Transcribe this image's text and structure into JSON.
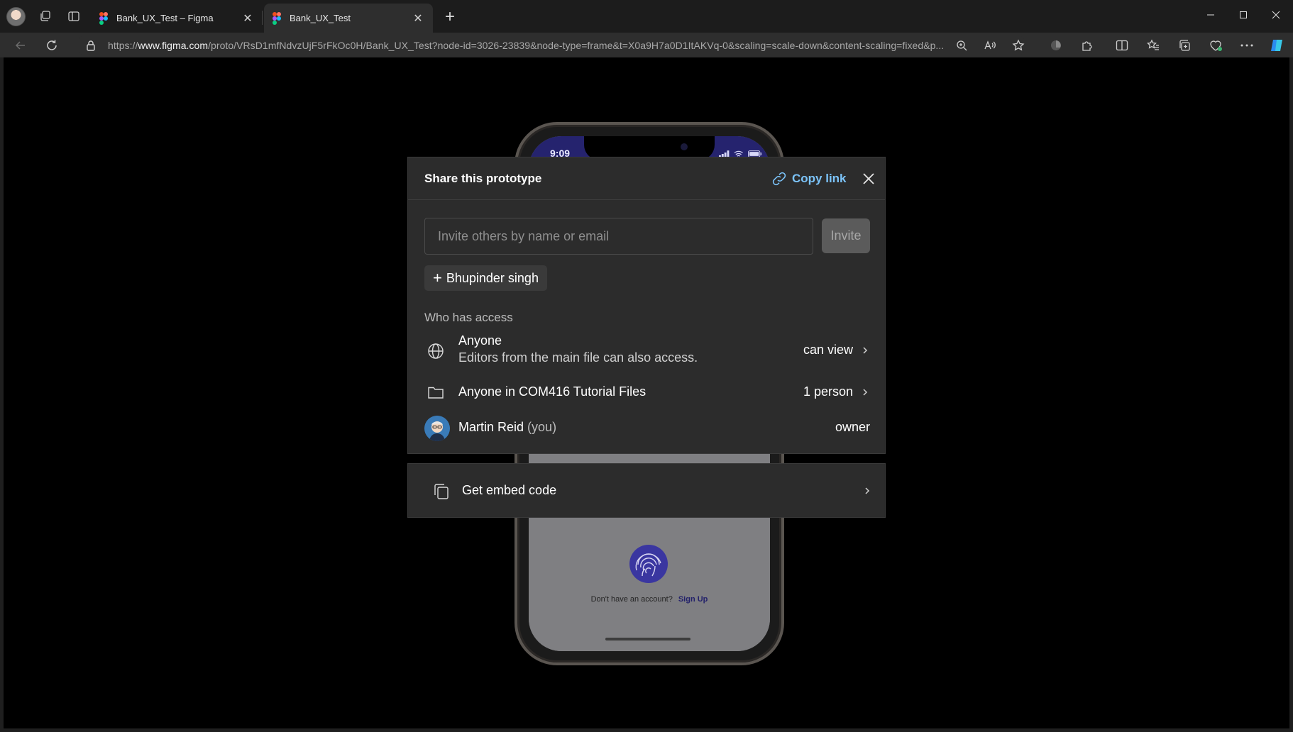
{
  "browser": {
    "tabs": [
      {
        "title": "Bank_UX_Test – Figma",
        "active": false
      },
      {
        "title": "Bank_UX_Test",
        "active": true
      }
    ],
    "url_prefix": "https://",
    "url_host": "www.figma.com",
    "url_rest": "/proto/VRsD1mfNdvzUjF5rFkOc0H/Bank_UX_Test?node-id=3026-23839&node-type=frame&t=X0a9H7a0D1ItAKVq-0&scaling=scale-down&content-scaling=fixed&p..."
  },
  "phone": {
    "time": "9:09",
    "no_account_text": "Don't have an account?",
    "signup_label": "Sign Up"
  },
  "share_dialog": {
    "title": "Share this prototype",
    "copy_link_label": "Copy link",
    "invite_placeholder": "Invite others by name or email",
    "invite_button_label": "Invite",
    "suggestion_label": "Bhupinder singh",
    "access_heading": "Who has access",
    "access": [
      {
        "name": "Anyone",
        "description": "Editors from the main file can also access.",
        "permission": "can view",
        "icon": "globe-icon"
      },
      {
        "name": "Anyone in COM416 Tutorial Files",
        "permission": "1 person",
        "icon": "folder-icon"
      },
      {
        "name": "Martin Reid",
        "qualifier": "(you)",
        "permission": "owner",
        "icon": "avatar"
      }
    ],
    "embed_label": "Get embed code"
  },
  "colors": {
    "accent_link": "#7cc4fa",
    "dialog_bg": "#2c2c2c",
    "phone_status": "#25236e"
  }
}
